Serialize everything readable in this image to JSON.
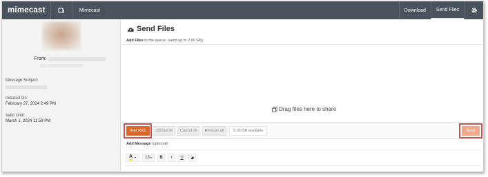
{
  "topbar": {
    "logo": "mimecast",
    "app_icon": "upload-tray-icon",
    "app_name": "Mimecast",
    "nav": [
      {
        "label": "Download",
        "active": false
      },
      {
        "label": "Send Files",
        "active": true
      }
    ],
    "settings_icon": "gear-icon"
  },
  "sidebar": {
    "from_label": "From:",
    "subject_label": "Message Subject:",
    "initiated_label": "Initiated On:",
    "initiated_value": "February 27, 2024 2:49 PM",
    "valid_label": "Valid Until:",
    "valid_value": "March 1, 2024 11:59 PM"
  },
  "main": {
    "title_icon": "cloud-upload-icon",
    "title": "Send Files",
    "hint_bold": "Add Files",
    "hint_rest": "to the queue. (send up to 2.00 GB)",
    "drop_icon": "copy-icon",
    "drop_text": "Drag files here to share",
    "buttons": {
      "add": "Add Files",
      "upload_all": "Upload all",
      "cancel_all": "Cancel all",
      "remove_all": "Remove all",
      "send": "Send"
    },
    "available": "2.00 GB available",
    "message_label_bold": "Add Message",
    "message_label_rest": "(optional)",
    "toolbar": {
      "font_color": "A",
      "font_size": "13",
      "bold": "B",
      "italic": "I",
      "underline": "U",
      "clear_format_icon": "eraser-icon"
    }
  },
  "colors": {
    "topbar_bg": "#4a535d",
    "add_files_bg": "#d8692a",
    "send_bg": "#f1a88b",
    "highlight": "#c6534f"
  }
}
